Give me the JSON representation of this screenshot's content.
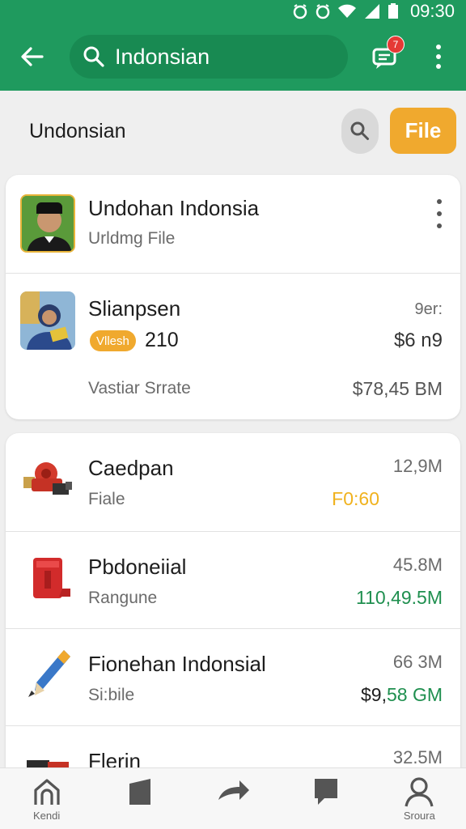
{
  "status_bar": {
    "time": "09:30"
  },
  "app_bar": {
    "search_value": "Indonsian",
    "chat_badge": "7"
  },
  "section": {
    "title": "Undonsian",
    "file_button": "File"
  },
  "card1": {
    "rows": [
      {
        "title": "Undohan Indonsia",
        "subtitle": "Urldmg File"
      },
      {
        "title": "Slianpsen",
        "chip": "Vllesh",
        "count": "210",
        "right_top": "9er:",
        "right_mid": "$6 n9",
        "subtitle": "Vastiar Srrate",
        "right_bottom": "$78,45 BM"
      }
    ]
  },
  "card2": {
    "rows": [
      {
        "title": "Caedpan",
        "subtitle": "Fiale",
        "size": "12,9M",
        "value": "F0:60",
        "value_color": "#f0b21e"
      },
      {
        "title": "Pbdoneiial",
        "subtitle": "Rangune",
        "size": "45.8M",
        "value": "110,49.5M",
        "value_color": "#1f8f4f"
      },
      {
        "title": "Fionehan Indonsial",
        "subtitle": "Si:bile",
        "size": "66 3M",
        "value_prefix": "$9,",
        "value": "58 GM",
        "value_color": "#1f8f4f"
      },
      {
        "title": "Flerin",
        "size": "32.5M"
      }
    ]
  },
  "bottom_nav": {
    "items": [
      {
        "label": "Kendi",
        "icon": "home-icon"
      },
      {
        "label": "",
        "icon": "bookmark-icon"
      },
      {
        "label": "",
        "icon": "share-icon"
      },
      {
        "label": "",
        "icon": "message-icon"
      },
      {
        "label": "Sroura",
        "icon": "profile-icon"
      }
    ]
  },
  "colors": {
    "primary": "#1f9a5e",
    "accent": "#f0a92e",
    "positive": "#1f8f4f"
  }
}
